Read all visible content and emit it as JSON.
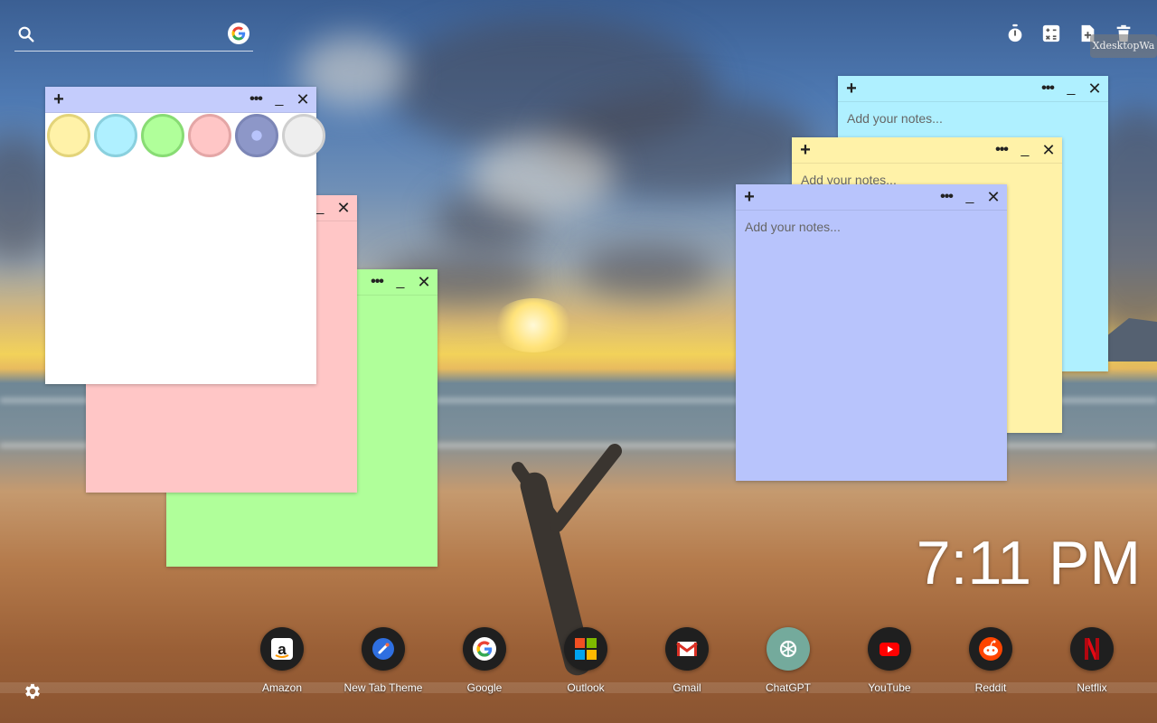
{
  "search": {
    "placeholder": "",
    "value": "",
    "icon": "search-icon",
    "engine_icon": "google-icon"
  },
  "toolbar": {
    "icons": [
      "stopwatch-icon",
      "calculator-icon",
      "new-note-icon",
      "trash-icon"
    ]
  },
  "notes": [
    {
      "id": "cyan",
      "color": "#aff0ff",
      "placeholder": "Add your notes..."
    },
    {
      "id": "yellow",
      "color": "#fff2a8",
      "placeholder": "Add your notes..."
    },
    {
      "id": "blue",
      "color": "#b8c4fc",
      "placeholder": "Add your notes..."
    },
    {
      "id": "green",
      "color": "#b0ff9a",
      "placeholder": ""
    },
    {
      "id": "pink",
      "color": "#ffc6c6",
      "placeholder": ""
    },
    {
      "id": "white",
      "color": "#ffffff",
      "header_color": "#c4ccfc",
      "placeholder": ""
    }
  ],
  "note_buttons": {
    "add": "+",
    "more": "•••",
    "minimize": "_",
    "close": "✕"
  },
  "palette": [
    "#fff2a8",
    "#aff0ff",
    "#b0ff9a",
    "#ffc6c6",
    "#8d97c8",
    "#eeeeee"
  ],
  "clock": {
    "time": "7:11 PM"
  },
  "dock": [
    {
      "label": "Amazon",
      "icon": "amazon-icon"
    },
    {
      "label": "New Tab Theme",
      "icon": "new-tab-theme-icon"
    },
    {
      "label": "Google",
      "icon": "google-icon"
    },
    {
      "label": "Outlook",
      "icon": "outlook-icon"
    },
    {
      "label": "Gmail",
      "icon": "gmail-icon"
    },
    {
      "label": "ChatGPT",
      "icon": "chatgpt-icon"
    },
    {
      "label": "YouTube",
      "icon": "youtube-icon"
    },
    {
      "label": "Reddit",
      "icon": "reddit-icon"
    },
    {
      "label": "Netflix",
      "icon": "netflix-icon"
    }
  ],
  "settings": {
    "icon": "gear-icon"
  }
}
